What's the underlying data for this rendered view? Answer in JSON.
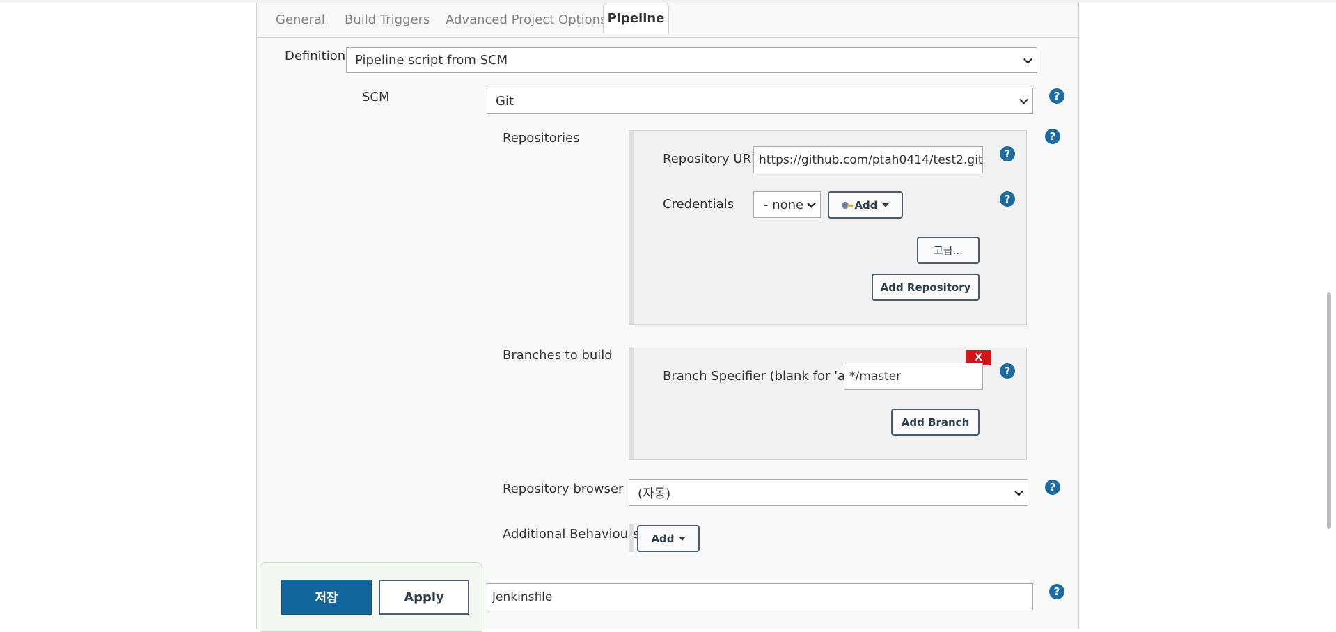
{
  "tabs": [
    {
      "label": "General"
    },
    {
      "label": "Build Triggers"
    },
    {
      "label": "Advanced Project Options"
    },
    {
      "label": "Pipeline",
      "active": true
    }
  ],
  "definition": {
    "label": "Definition",
    "value": "Pipeline script from SCM"
  },
  "scm": {
    "label": "SCM",
    "value": "Git"
  },
  "repositories": {
    "label": "Repositories",
    "repository_url_label": "Repository URL",
    "repository_url_value": "https://github.com/ptah0414/test2.git",
    "credentials_label": "Credentials",
    "credentials_value": "- none -",
    "add_label": "Add",
    "advanced_label": "고급...",
    "add_repository_label": "Add Repository"
  },
  "branches": {
    "label": "Branches to build",
    "remove_label": "X",
    "specifier_label": "Branch Specifier (blank for 'any')",
    "specifier_value": "*/master",
    "add_branch_label": "Add Branch"
  },
  "repository_browser": {
    "label": "Repository browser",
    "value": "(자동)"
  },
  "additional_behaviours": {
    "label": "Additional Behaviours",
    "add_label": "Add"
  },
  "script_path": {
    "value": "Jenkinsfile"
  },
  "footer": {
    "save_label": "저장",
    "apply_label": "Apply"
  },
  "help_symbol": "?",
  "colors": {
    "accent": "#13659d",
    "danger": "#d0161a",
    "help": "#1c6ca1"
  }
}
